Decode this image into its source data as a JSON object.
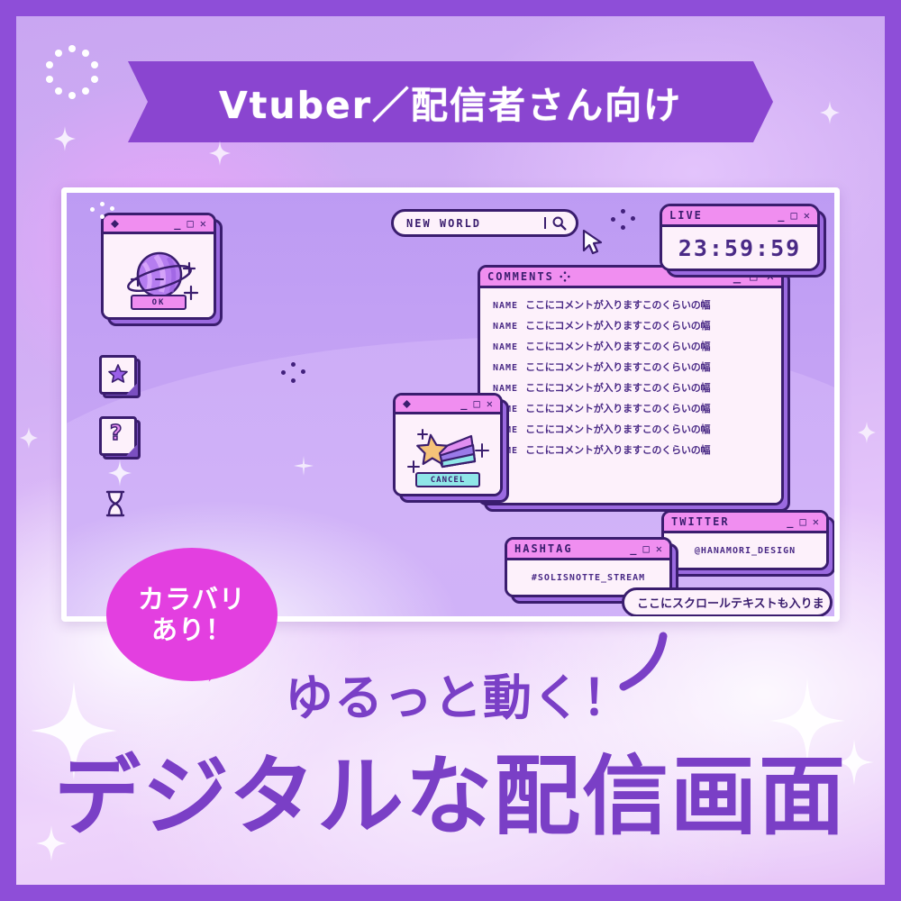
{
  "ribbon": {
    "text": "Vtuber／配信者さん向け"
  },
  "headings": {
    "sub": "ゆるっと動く！",
    "main": "デジタルな配信画面",
    "bubble_line1": "カラバリ",
    "bubble_line2": "あり！"
  },
  "screen": {
    "search_top": {
      "value": "NEW WORLD",
      "placeholder": "NEW WORLD",
      "icon": "search-icon"
    },
    "search_bottom": {
      "value": "ここにスクロールテキストも入りま",
      "placeholder": "ここにスクロールテキストも入りま",
      "icon": "search-icon"
    },
    "windows": {
      "planet": {
        "title": "",
        "button": "OK",
        "icon": "planet-icon"
      },
      "star": {
        "title": "",
        "button": "CANCEL",
        "icon": "shooting-star-icon"
      },
      "live": {
        "title": "LIVE",
        "timer": "23:59:59"
      },
      "comments": {
        "title": "COMMENTS",
        "rows": [
          {
            "name": "NAME",
            "text": "ここにコメントが入りますこのくらいの幅"
          },
          {
            "name": "NAME",
            "text": "ここにコメントが入りますこのくらいの幅"
          },
          {
            "name": "NAME",
            "text": "ここにコメントが入りますこのくらいの幅"
          },
          {
            "name": "NAME",
            "text": "ここにコメントが入りますこのくらいの幅"
          },
          {
            "name": "NAME",
            "text": "ここにコメントが入りますこのくらいの幅"
          },
          {
            "name": "NAME",
            "text": "ここにコメントが入りますこのくらいの幅"
          },
          {
            "name": "NAME",
            "text": "ここにコメントが入りますこのくらいの幅"
          },
          {
            "name": "NAME",
            "text": "ここにコメントが入りますこのくらいの幅"
          }
        ]
      },
      "hashtag": {
        "title": "HASHTAG",
        "value": "#SOLISNOTTE_STREAM"
      },
      "twitter": {
        "title": "TWITTER",
        "value": "@HANAMORI_DESIGN"
      }
    },
    "window_controls": {
      "minimize": "_",
      "maximize": "□",
      "close": "✕"
    },
    "desktop_icons": [
      {
        "name": "star-file-icon",
        "glyph": "★"
      },
      {
        "name": "help-file-icon",
        "glyph": "?"
      },
      {
        "name": "hourglass-icon",
        "glyph": "⌛"
      }
    ]
  },
  "colors": {
    "frame_purple": "#8e4ed8",
    "ribbon_purple": "#8a45d0",
    "bubble_magenta": "#e33fe0",
    "heading_purple": "#7a3fc6",
    "window_outline": "#3a1d6e",
    "titlebar_pink": "#f08ef0",
    "window_bg": "#fdf1fb",
    "ok_button": "#ef8df0",
    "cancel_button": "#8fe6e8"
  }
}
